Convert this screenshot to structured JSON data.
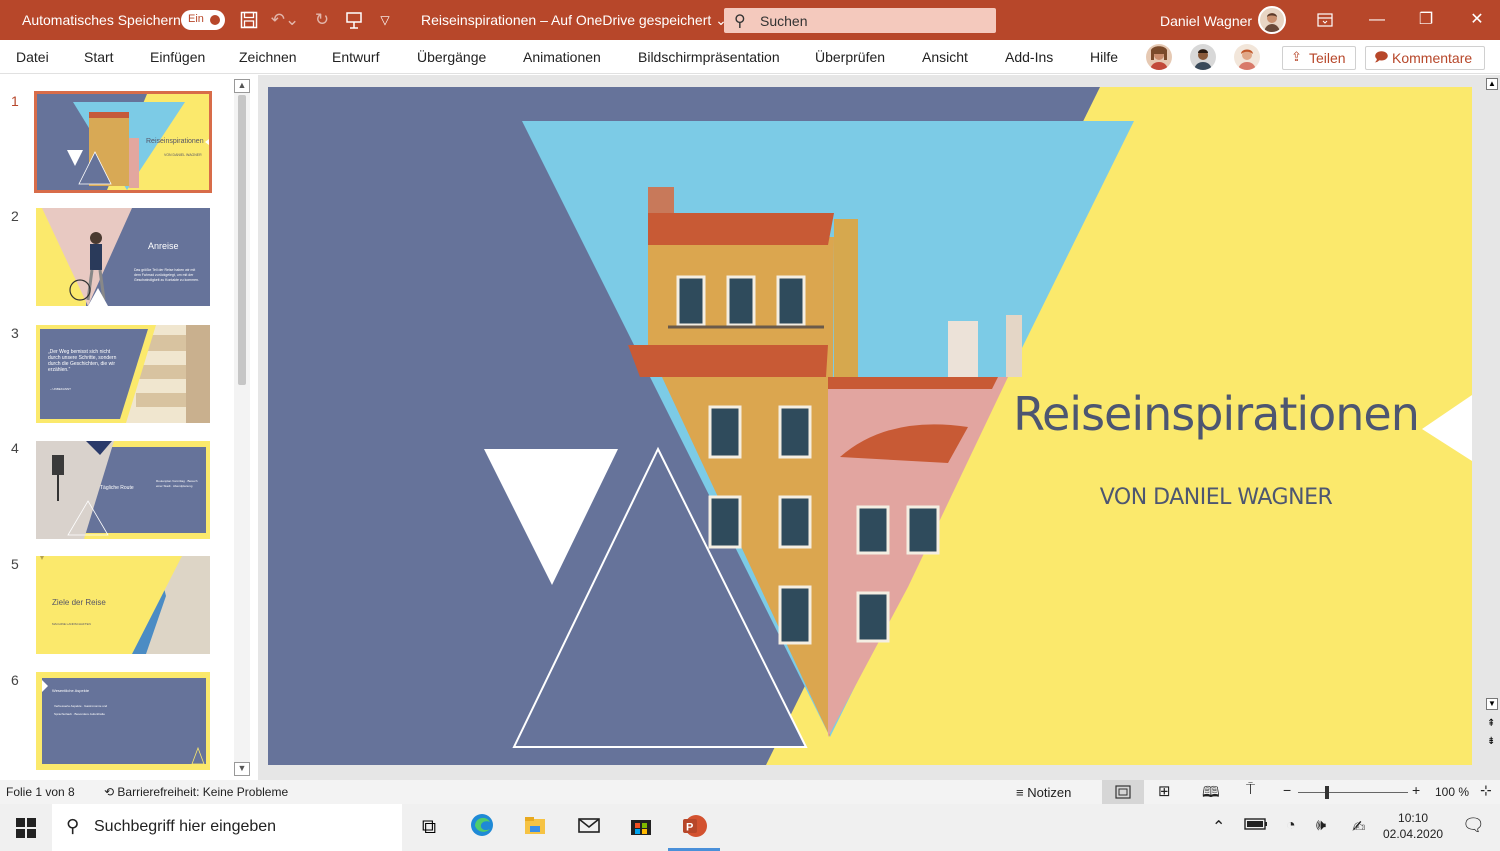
{
  "titlebar": {
    "autosave_label": "Automatisches Speichern",
    "autosave_state": "Ein",
    "doc_title": "Reiseinspirationen – Auf OneDrive gespeichert",
    "search_placeholder": "Suchen",
    "user_name": "Daniel Wagner"
  },
  "ribbon": {
    "tabs": [
      "Datei",
      "Start",
      "Einfügen",
      "Zeichnen",
      "Entwurf",
      "Übergänge",
      "Animationen",
      "Bildschirmpräsentation",
      "Überprüfen",
      "Ansicht",
      "Add-Ins",
      "Hilfe"
    ],
    "share_label": "Teilen",
    "comments_label": "Kommentare"
  },
  "thumbnails": [
    {
      "num": "1",
      "title": "Reiseinspirationen",
      "sub": "VON DANIEL WAGNER"
    },
    {
      "num": "2",
      "title": "Anreise",
      "sub": "Das größte Teil der Reise haben wir mit dem Fahrrad zurückgelegt, um mit der Geschwindigkeit zu Kontakte zu kommen."
    },
    {
      "num": "3",
      "title": "„Der Weg bemisst sich nicht durch unsere Schritte, sondern durch die Geschichten, die wir erzählen.“",
      "sub": "– UNBEKANNT"
    },
    {
      "num": "4",
      "title": "Tägliche Route",
      "sub": "Routenplan Vormittag · Besuch einer Stadt · Abendplanung"
    },
    {
      "num": "5",
      "title": "Ziele der Reise",
      "sub": "MACHINE LANDSCHAFTEN"
    },
    {
      "num": "6",
      "title": "Wesentliche Aspekte",
      "sub": "Verbesserte Aspekte · Gastronomie und Sprachurlaub · Besondere Aufenthalte"
    }
  ],
  "slide": {
    "title": "Reiseinspirationen",
    "subtitle": "VON DANIEL WAGNER"
  },
  "statusbar": {
    "slide_info": "Folie 1 von 8",
    "accessibility": "Barrierefreiheit: Keine Probleme",
    "notes": "Notizen",
    "zoom": "100 %"
  },
  "taskbar": {
    "search_placeholder": "Suchbegriff hier eingeben",
    "time": "10:10",
    "date": "02.04.2020"
  },
  "colors": {
    "accent": "#b7472a",
    "slide_blue": "#66739a",
    "slide_yellow": "#fbe96c",
    "sky": "#7ccbe6"
  }
}
